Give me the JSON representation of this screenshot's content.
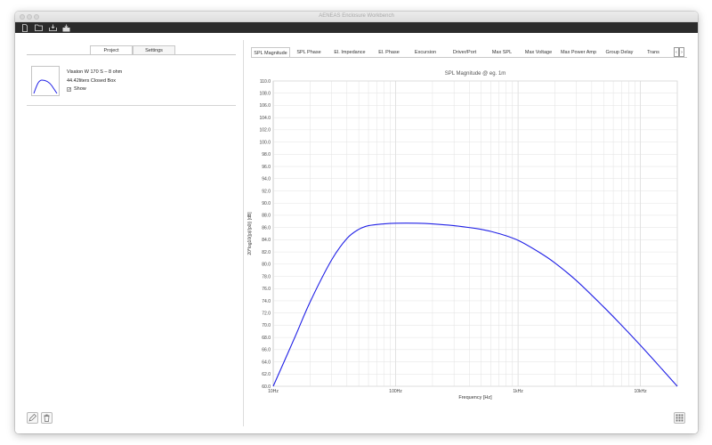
{
  "window": {
    "title": "AENEAS Enclosure Workbench"
  },
  "toolbar": {
    "icons": [
      "new-file-icon",
      "open-folder-icon",
      "save-icon",
      "export-icon"
    ]
  },
  "left": {
    "tabs": [
      "Project",
      "Settings"
    ],
    "active_tab": "Project",
    "project": {
      "driver": "Visaton W 170 S – 8 ohm",
      "enclosure": "44.42liters Closed Box",
      "show_label": "Show",
      "show_checked": "✓"
    },
    "buttons": [
      "edit-icon",
      "delete-icon"
    ]
  },
  "right": {
    "tabs": [
      "SPL Magnitude",
      "SPL Phase",
      "El. Impedance",
      "El. Phase",
      "Excursion",
      "Driver/Port",
      "Max SPL",
      "Max Voltage",
      "Max Power Amp",
      "Group Delay",
      "Trans"
    ],
    "active_tab": "SPL Magnitude",
    "scroll_left": "‹",
    "scroll_right": "›"
  },
  "chart_data": {
    "type": "line",
    "title": "SPL Magnitude @ eg. 1m",
    "xlabel": "Frequency [Hz]",
    "ylabel": "20*log10(|p|/|p0|) [dB]",
    "xscale": "log",
    "xlim": [
      10,
      20000
    ],
    "ylim": [
      60,
      110
    ],
    "x_ticks": [
      10,
      100,
      1000,
      10000
    ],
    "x_tick_labels": [
      "10Hz",
      "100Hz",
      "1kHz",
      "10kHz"
    ],
    "y_ticks": [
      60.0,
      62.0,
      64.0,
      66.0,
      68.0,
      70.0,
      72.0,
      74.0,
      76.0,
      78.0,
      80.0,
      82.0,
      84.0,
      86.0,
      88.0,
      90.0,
      92.0,
      94.0,
      96.0,
      98.0,
      100.0,
      102.0,
      104.0,
      106.0,
      108.0,
      110.0
    ],
    "grid": true,
    "line_color": "#2020e6",
    "series": [
      {
        "x": [
          10,
          15,
          20,
          30,
          40,
          50,
          60,
          80,
          100,
          150,
          200,
          300,
          500,
          700,
          1000,
          1500,
          2000,
          3000,
          5000,
          7000,
          10000,
          15000,
          20000
        ],
        "y": [
          60.0,
          68.0,
          73.8,
          80.7,
          84.2,
          85.7,
          86.3,
          86.6,
          86.7,
          86.7,
          86.6,
          86.3,
          85.7,
          85.0,
          83.9,
          81.9,
          80.2,
          77.3,
          73.0,
          70.0,
          66.7,
          62.8,
          60.0
        ]
      }
    ]
  }
}
